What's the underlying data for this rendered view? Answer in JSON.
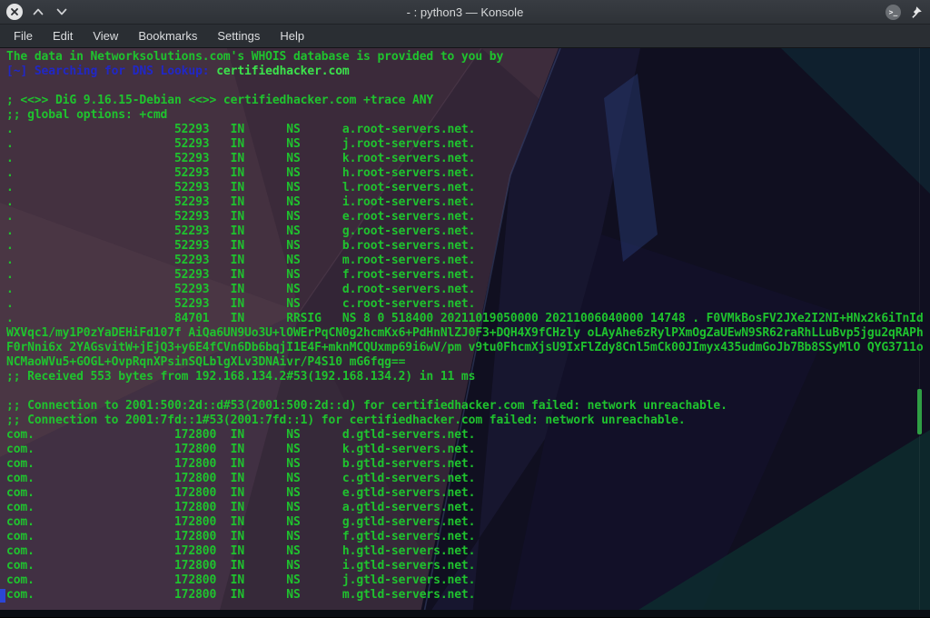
{
  "window": {
    "title": "- : python3 — Konsole"
  },
  "icons": {
    "close_glyph": "✕",
    "konsole_glyph": ">_"
  },
  "menu": {
    "items": [
      "File",
      "Edit",
      "View",
      "Bookmarks",
      "Settings",
      "Help"
    ]
  },
  "colors": {
    "green": "#1fc32e",
    "bright_green": "#3ce24c",
    "blue": "#2127c6",
    "cursor_blue": "#2b46d6",
    "scrollbar_green": "#2f9e44"
  },
  "terminal": {
    "whois_notice": "The data in Networksolutions.com's WHOIS database is provided to you by",
    "search_prefix": "[~] Searching for DNS Lookup: ",
    "search_target": "certifiedhacker.com",
    "dig_header": "; <<>> DiG 9.16.15-Debian <<>> certifiedhacker.com +trace ANY",
    "global_options": ";; global options: +cmd",
    "root_ns_records": [
      {
        "name": ".",
        "ttl": "52293",
        "class": "IN",
        "type": "NS",
        "value": "a.root-servers.net."
      },
      {
        "name": ".",
        "ttl": "52293",
        "class": "IN",
        "type": "NS",
        "value": "j.root-servers.net."
      },
      {
        "name": ".",
        "ttl": "52293",
        "class": "IN",
        "type": "NS",
        "value": "k.root-servers.net."
      },
      {
        "name": ".",
        "ttl": "52293",
        "class": "IN",
        "type": "NS",
        "value": "h.root-servers.net."
      },
      {
        "name": ".",
        "ttl": "52293",
        "class": "IN",
        "type": "NS",
        "value": "l.root-servers.net."
      },
      {
        "name": ".",
        "ttl": "52293",
        "class": "IN",
        "type": "NS",
        "value": "i.root-servers.net."
      },
      {
        "name": ".",
        "ttl": "52293",
        "class": "IN",
        "type": "NS",
        "value": "e.root-servers.net."
      },
      {
        "name": ".",
        "ttl": "52293",
        "class": "IN",
        "type": "NS",
        "value": "g.root-servers.net."
      },
      {
        "name": ".",
        "ttl": "52293",
        "class": "IN",
        "type": "NS",
        "value": "b.root-servers.net."
      },
      {
        "name": ".",
        "ttl": "52293",
        "class": "IN",
        "type": "NS",
        "value": "m.root-servers.net."
      },
      {
        "name": ".",
        "ttl": "52293",
        "class": "IN",
        "type": "NS",
        "value": "f.root-servers.net."
      },
      {
        "name": ".",
        "ttl": "52293",
        "class": "IN",
        "type": "NS",
        "value": "d.root-servers.net."
      },
      {
        "name": ".",
        "ttl": "52293",
        "class": "IN",
        "type": "NS",
        "value": "c.root-servers.net."
      }
    ],
    "rrsig_record": {
      "name": ".",
      "ttl": "84701",
      "class": "IN",
      "type": "RRSIG",
      "value": "NS 8 0 518400 20211019050000 20211006040000 14748 . F0VMkBosFV2JXe2I2NI+HNx2k6iTnId"
    },
    "rrsig_continuation": [
      "WXVqc1/my1P0zYaDEHiFd107f AiQa6UN9Uo3U+lOWErPqCN0g2hcmKx6+PdHnNlZJ0F3+DQH4X9fCHzly oLAyAhe6zRylPXmOgZaUEwN9SR62raRhLLuBvp5jgu2qRAPh",
      "F0rNni6x 2YAGsvitW+jEjQ3+y6E4fCVn6Db6bqjI1E4F+mknMCQUxmp69i6wV/pm v9tu0FhcmXjsU9IxFlZdy8Cnl5mCk00JImyx435udmGoJb7Bb8SSyMlO QYG3711o",
      "NCMaoWVu5+GOGL+OvpRqnXPsinSQLblgXLv3DNAivr/P4S10 mG6fqg=="
    ],
    "received_notice": ";; Received 553 bytes from 192.168.134.2#53(192.168.134.2) in 11 ms",
    "connection_errors": [
      ";; Connection to 2001:500:2d::d#53(2001:500:2d::d) for certifiedhacker.com failed: network unreachable.",
      ";; Connection to 2001:7fd::1#53(2001:7fd::1) for certifiedhacker.com failed: network unreachable."
    ],
    "com_ns_records": [
      {
        "name": "com.",
        "ttl": "172800",
        "class": "IN",
        "type": "NS",
        "value": "d.gtld-servers.net."
      },
      {
        "name": "com.",
        "ttl": "172800",
        "class": "IN",
        "type": "NS",
        "value": "k.gtld-servers.net."
      },
      {
        "name": "com.",
        "ttl": "172800",
        "class": "IN",
        "type": "NS",
        "value": "b.gtld-servers.net."
      },
      {
        "name": "com.",
        "ttl": "172800",
        "class": "IN",
        "type": "NS",
        "value": "c.gtld-servers.net."
      },
      {
        "name": "com.",
        "ttl": "172800",
        "class": "IN",
        "type": "NS",
        "value": "e.gtld-servers.net."
      },
      {
        "name": "com.",
        "ttl": "172800",
        "class": "IN",
        "type": "NS",
        "value": "a.gtld-servers.net."
      },
      {
        "name": "com.",
        "ttl": "172800",
        "class": "IN",
        "type": "NS",
        "value": "g.gtld-servers.net."
      },
      {
        "name": "com.",
        "ttl": "172800",
        "class": "IN",
        "type": "NS",
        "value": "f.gtld-servers.net."
      },
      {
        "name": "com.",
        "ttl": "172800",
        "class": "IN",
        "type": "NS",
        "value": "h.gtld-servers.net."
      },
      {
        "name": "com.",
        "ttl": "172800",
        "class": "IN",
        "type": "NS",
        "value": "i.gtld-servers.net."
      },
      {
        "name": "com.",
        "ttl": "172800",
        "class": "IN",
        "type": "NS",
        "value": "j.gtld-servers.net."
      },
      {
        "name": "com.",
        "ttl": "172800",
        "class": "IN",
        "type": "NS",
        "value": "m.gtld-servers.net."
      }
    ]
  }
}
